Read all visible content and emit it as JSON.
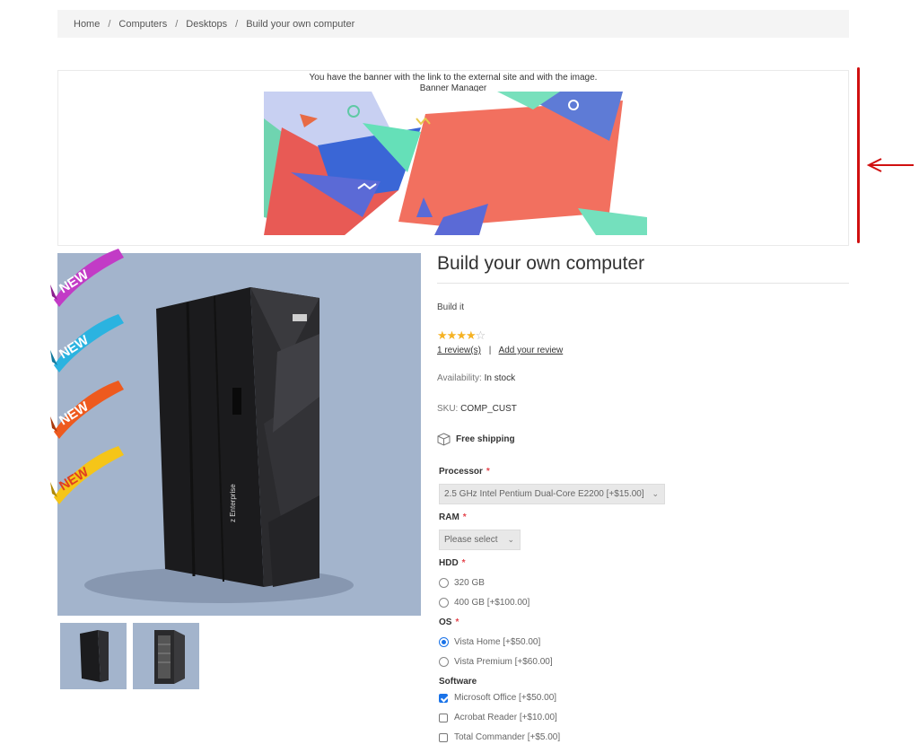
{
  "breadcrumb": {
    "items": [
      "Home",
      "Computers",
      "Desktops",
      "Build your own computer"
    ],
    "separator": "/"
  },
  "banner": {
    "line1": "You have the banner with the link to the external site and with the image.",
    "line2": "Banner Manager"
  },
  "product": {
    "title": "Build your own computer",
    "short_description": "Build it",
    "rating": {
      "value": 4,
      "max": 5
    },
    "reviews_link": "1 review(s)",
    "review_separator": "|",
    "add_review_link": "Add your review",
    "availability_label": "Availability:",
    "availability_value": "In stock",
    "sku_label": "SKU:",
    "sku_value": "COMP_CUST",
    "shipping": "Free shipping",
    "ribbon_text": "NEW",
    "ribbon_colors": [
      "#c23bc6",
      "#2bb3e0",
      "#ee5a1e",
      "#f5c518"
    ]
  },
  "attributes": {
    "processor": {
      "label": "Processor",
      "required": "*",
      "selected": "2.5 GHz Intel Pentium Dual-Core E2200 [+$15.00]"
    },
    "ram": {
      "label": "RAM",
      "required": "*",
      "selected": "Please select"
    },
    "hdd": {
      "label": "HDD",
      "required": "*",
      "options": [
        "320 GB",
        "400 GB [+$100.00]"
      ],
      "checked": null
    },
    "os": {
      "label": "OS",
      "required": "*",
      "options": [
        "Vista Home [+$50.00]",
        "Vista Premium [+$60.00]"
      ],
      "checked": 0
    },
    "software": {
      "label": "Software",
      "options": [
        "Microsoft Office [+$50.00]",
        "Acrobat Reader [+$10.00]",
        "Total Commander [+$5.00]"
      ],
      "checked": [
        0
      ]
    }
  },
  "annotation": {
    "color": "#d01010"
  }
}
